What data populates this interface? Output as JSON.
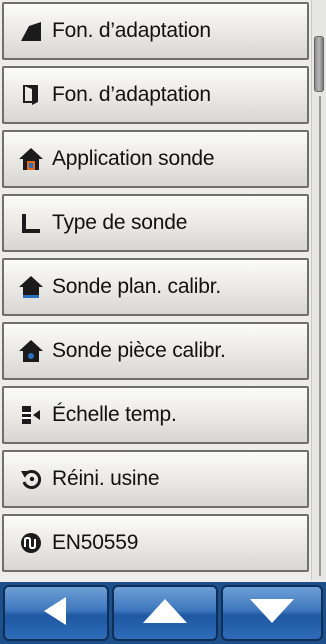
{
  "menu": {
    "items": [
      {
        "label": "Fon. d’adaptation",
        "icon": "window-open-icon"
      },
      {
        "label": "Fon. d’adaptation",
        "icon": "door-icon"
      },
      {
        "label": "Application sonde",
        "icon": "house-thermometer-icon"
      },
      {
        "label": "Type de sonde",
        "icon": "sensor-probe-icon"
      },
      {
        "label": "Sonde plan. calibr.",
        "icon": "house-floor-icon"
      },
      {
        "label": "Sonde pièce calibr.",
        "icon": "house-room-icon"
      },
      {
        "label": "Échelle temp.",
        "icon": "temperature-scale-icon"
      },
      {
        "label": "Réini. usine",
        "icon": "reset-icon"
      },
      {
        "label": "EN50559",
        "icon": "en50559-icon"
      }
    ]
  },
  "nav": {
    "back": "left-arrow-icon",
    "up": "up-arrow-icon",
    "down": "down-arrow-icon"
  },
  "colors": {
    "nav_bg": "#1d4f8a",
    "button_face": "#e9e8e5",
    "icon": "#1b1b1b"
  }
}
